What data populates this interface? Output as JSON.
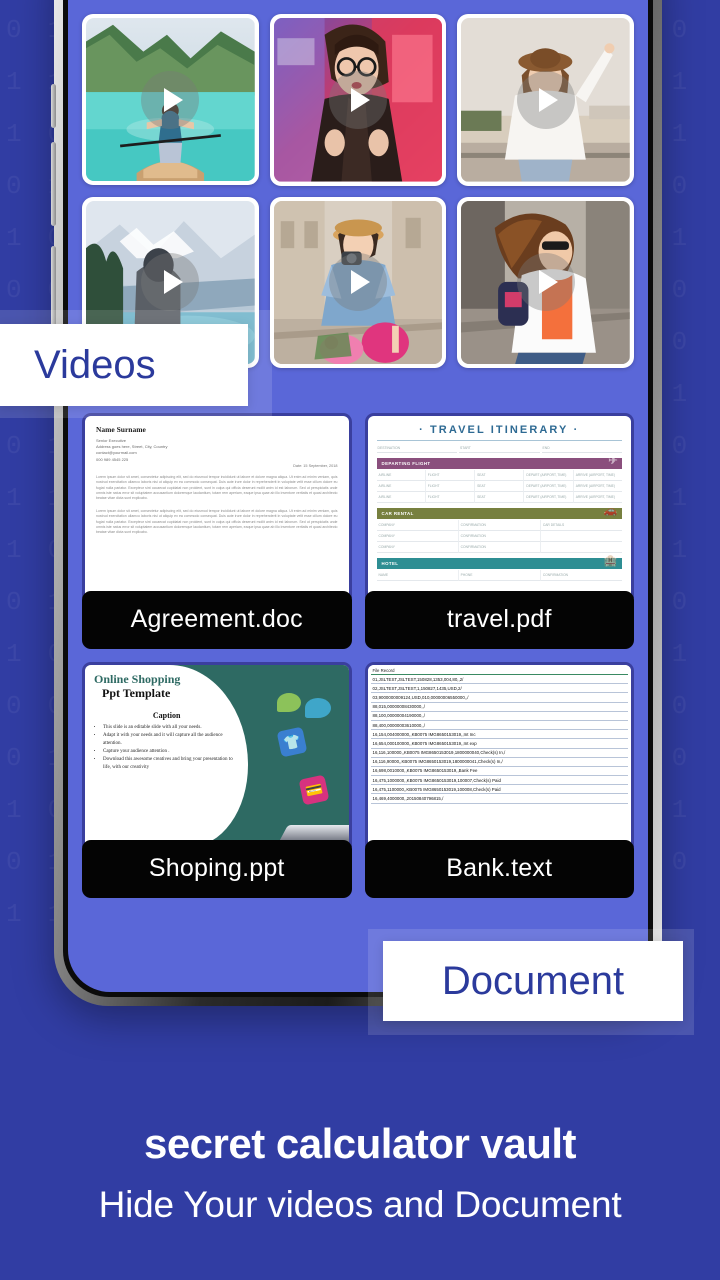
{
  "background": {
    "pattern": "0110100101101001011010010110100101101001011010010110100101101001011010010110100101101001011010010110100101101001011010010110100101101001011010010110100101101001011010010110100101101001011010010110100101101001011010010110100101101001011010010110100101101001011010010110100101101001011010010110100101101001",
    "color": "#313da3"
  },
  "phone": {
    "screen_color": "#5a67d8",
    "bezel_color": "#1b1b1b"
  },
  "labels": {
    "videos": "Videos",
    "document": "Document"
  },
  "videos": [
    {
      "name": "lake-canoe-woman",
      "play_icon": "play-icon"
    },
    {
      "name": "city-train-woman-glasses",
      "play_icon": "play-icon"
    },
    {
      "name": "beach-road-woman-hat",
      "play_icon": "play-icon"
    },
    {
      "name": "mountain-lake-hiker",
      "play_icon": "play-icon"
    },
    {
      "name": "street-woman-camera-flowers",
      "play_icon": "play-icon"
    },
    {
      "name": "street-woman-sunglasses-backpack",
      "play_icon": "play-icon"
    }
  ],
  "documents": [
    {
      "filename": "Agreement.doc",
      "type": "doc"
    },
    {
      "filename": "travel.pdf",
      "type": "pdf"
    },
    {
      "filename": "Shoping.ppt",
      "type": "ppt"
    },
    {
      "filename": "Bank.text",
      "type": "text"
    }
  ],
  "agreement_preview": {
    "name": "Name Surname",
    "title": "Senior Executive",
    "address": "Address goes here, Street, City, Country",
    "email": "contact@yourmail.com",
    "phone": "000 989 4545 225",
    "date": "Date: 15 September, 2018",
    "paragraph": "Lorem ipsum dolor sit amet, consectetur adipiscing elit, sed do eiusmod tempor incididunt ut labore et dolore magna aliqua. Ut enim ad minim veniam, quis nostrud exercitation ullamco laboris nisi ut aliquip ex ea commodo consequat. Duis aute irure dolor in reprehenderit in voluptate velit esse cillum dolore eu fugiat nulla pariatur. Excepteur sint occaecat cupidatat non proident, sunt in culpa qui officia deserunt mollit anim id est laborum. Sed ut perspiciatis unde omnis iste natus error sit voluptatem accusantium doloremque laudantium, totam rem aperiam, eaque ipsa quae ab illo inventore veritatis et quasi architecto beatae vitae dicta sunt explicabo."
  },
  "travel_preview": {
    "title": "TRAVEL ITINERARY",
    "top_columns": [
      "DESTINATION",
      "START",
      "END"
    ],
    "sections": [
      {
        "band": "DEPARTING FLIGHT",
        "color": "#8a4f7d",
        "icon": "airplane-icon",
        "columns": [
          "AIRLINE",
          "FLIGHT",
          "SEAT",
          "DEPART (AIRPORT, TIME)",
          "ARRIVE (AIRPORT, TIME)"
        ],
        "rows": 3
      },
      {
        "band": "CAR RENTAL",
        "color": "#77803f",
        "icon": "car-icon",
        "columns": [
          "COMPANY",
          "CONFIRMATION",
          "CAR DETAILS"
        ],
        "rows": 3
      },
      {
        "band": "HOTEL",
        "color": "#2e8e93",
        "icon": "hotel-icon",
        "columns": [
          "NAME",
          "PHONE",
          "CONFIRMATION"
        ],
        "rows": 1
      }
    ]
  },
  "ppt_preview": {
    "title_line1": "Online Shopping",
    "title_line2": "Ppt Template",
    "caption": "Caption",
    "bullets": [
      "This slide is an editable slide with all your needs.",
      "Adapt it with your needs and it will capture all the audience attention.",
      "Capture your audience attention .",
      "Download this awesome creatives and bring your presentation to life, with our creativity"
    ],
    "icons": [
      "shirt-icon",
      "card-swipe-icon",
      "chat-bubble-icon",
      "chat-bubble-icon"
    ]
  },
  "bank_preview": {
    "header": "File Record",
    "lines": [
      "01,JSLTEST,JSLTEST,150828,1353,004,80,,2/",
      "02,JSLTEST,JSLTEST,1,150827,1435,USD,2/",
      "03,9000000009124,USD,010,00000006550000,,/",
      "88,015,00000008430000,,/",
      "88,100,00000004190000,,/",
      "88,400,00000003610000,,/",
      "16,154,004000000,,KB0075 IMG8650153019,,Int Inc",
      "16,654,000100000,,KB0075 IMG8650153019,,Int exp",
      "16,116,100000,,KB0075 IMG8650153019,1800000040,Check(s) In,/",
      "16,116,90000,,KB0075 IMG8650153019,1800000041,Check(s) In,/",
      "16,698,0010000,,KB0075 IMG8650153019,,Bank Fee",
      "16,475,1000000,,KB0075 IMG8650153019,100007,Check(s) Paid",
      "16,475,1100000,,KB0075 IMG8650153019,100008,Check(s) Paid",
      "16,469,4000000,,20150840796815,/"
    ]
  },
  "footer": {
    "headline": "secret calculator vault",
    "subhead": "Hide Your videos and Document"
  }
}
